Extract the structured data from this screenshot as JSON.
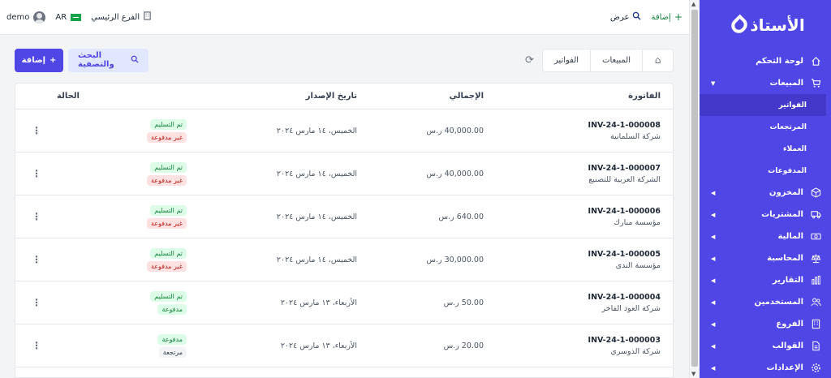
{
  "sidebar": {
    "logo": "الأستاذ",
    "items": [
      {
        "label": "لوحة التحكم",
        "icon": "home-icon",
        "caret": false,
        "type": "main"
      },
      {
        "label": "المبيعات",
        "icon": "cart-icon",
        "caret": true,
        "caret_dir": "down",
        "type": "main"
      },
      {
        "label": "الفواتير",
        "type": "sub",
        "active": true
      },
      {
        "label": "المرتجعات",
        "type": "sub"
      },
      {
        "label": "العملاء",
        "type": "sub"
      },
      {
        "label": "المدفوعات",
        "type": "sub"
      },
      {
        "label": "المخزون",
        "icon": "box-icon",
        "caret": true,
        "type": "main"
      },
      {
        "label": "المشتريات",
        "icon": "truck-icon",
        "caret": true,
        "type": "main"
      },
      {
        "label": "المالية",
        "icon": "money-icon",
        "caret": true,
        "type": "main"
      },
      {
        "label": "المحاسبة",
        "icon": "scale-icon",
        "caret": true,
        "type": "main"
      },
      {
        "label": "التقارير",
        "icon": "bar-chart-icon",
        "caret": true,
        "type": "main"
      },
      {
        "label": "المستخدمين",
        "icon": "users-icon",
        "caret": true,
        "type": "main"
      },
      {
        "label": "الفروع",
        "icon": "building-icon",
        "caret": true,
        "type": "main"
      },
      {
        "label": "القوالب",
        "icon": "document-icon",
        "caret": true,
        "type": "main"
      },
      {
        "label": "الإعدادات",
        "icon": "gear-icon",
        "caret": true,
        "type": "main"
      }
    ]
  },
  "topbar": {
    "user": "demo",
    "lang": "AR",
    "branch": "الفرع الرئيسي",
    "view_label": "عرض",
    "add_label": "إضافة"
  },
  "toolbar": {
    "add_label": "إضافة",
    "search_label": "البحث والتصفية",
    "breadcrumb": [
      "المبيعات",
      "الفواتير"
    ]
  },
  "table": {
    "headers": {
      "invoice": "الفاتورة",
      "total": "الإجمالي",
      "date": "تاريخ الإصدار",
      "status": "الحالة"
    },
    "rows": [
      {
        "invoice": "INV-24-1-000008",
        "customer": "شركة السلمانية",
        "total": "40,000.00 ر.س",
        "date": "الخميس، ١٤ مارس ٢٠٢٤",
        "badges": [
          {
            "text": "تم التسليم",
            "tone": "green"
          },
          {
            "text": "غير مدفوعة",
            "tone": "red"
          }
        ]
      },
      {
        "invoice": "INV-24-1-000007",
        "customer": "الشركة العربية للتصنيع",
        "total": "40,000.00 ر.س",
        "date": "الخميس، ١٤ مارس ٢٠٢٤",
        "badges": [
          {
            "text": "تم التسليم",
            "tone": "green"
          },
          {
            "text": "غير مدفوعة",
            "tone": "red"
          }
        ]
      },
      {
        "invoice": "INV-24-1-000006",
        "customer": "مؤسسة مبارك",
        "total": "640.00 ر.س",
        "date": "الخميس، ١٤ مارس ٢٠٢٤",
        "badges": [
          {
            "text": "تم التسليم",
            "tone": "green"
          },
          {
            "text": "غير مدفوعة",
            "tone": "red"
          }
        ]
      },
      {
        "invoice": "INV-24-1-000005",
        "customer": "مؤسسة الندى",
        "total": "30,000.00 ر.س",
        "date": "الخميس، ١٤ مارس ٢٠٢٤",
        "badges": [
          {
            "text": "تم التسليم",
            "tone": "green"
          },
          {
            "text": "غير مدفوعة",
            "tone": "red"
          }
        ]
      },
      {
        "invoice": "INV-24-1-000004",
        "customer": "شركة العود الفاخر",
        "total": "50.00 ر.س",
        "date": "الأربعاء، ١٣ مارس ٢٠٢٤",
        "badges": [
          {
            "text": "تم التسليم",
            "tone": "green"
          },
          {
            "text": "مدفوعة",
            "tone": "green"
          }
        ]
      },
      {
        "invoice": "INV-24-1-000003",
        "customer": "شركة الذوسري",
        "total": "20.00 ر.س",
        "date": "الأربعاء، ١٣ مارس ٢٠٢٤",
        "badges": [
          {
            "text": "مدفوعة",
            "tone": "green"
          },
          {
            "text": "مرتجعة",
            "tone": "gray"
          }
        ]
      }
    ]
  },
  "colors": {
    "primary": "#4f46e5",
    "sidebar_active": "#4338ca",
    "success": "#15803d",
    "danger": "#b91c1c"
  }
}
